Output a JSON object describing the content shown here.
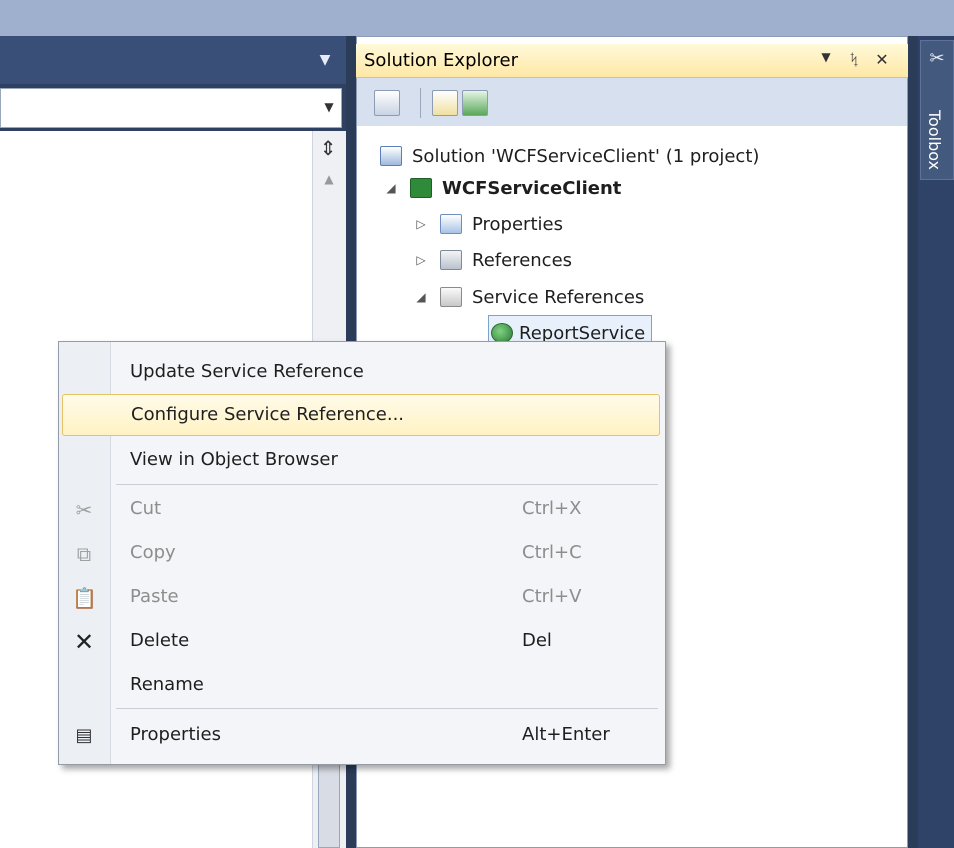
{
  "solution_explorer": {
    "title": "Solution Explorer",
    "tree": {
      "solution": "Solution 'WCFServiceClient' (1 project)",
      "project": "WCFServiceClient",
      "properties": "Properties",
      "references": "References",
      "service_references": "Service References",
      "report_service": "ReportService"
    }
  },
  "toolbox": {
    "label": "Toolbox"
  },
  "context_menu": {
    "items": [
      {
        "label": "Update Service Reference",
        "shortcut": "",
        "state": "normal"
      },
      {
        "label": "Configure Service Reference...",
        "shortcut": "",
        "state": "highlighted"
      },
      {
        "label": "View in Object Browser",
        "shortcut": "",
        "state": "normal"
      },
      {
        "label": "Cut",
        "shortcut": "Ctrl+X",
        "state": "disabled"
      },
      {
        "label": "Copy",
        "shortcut": "Ctrl+C",
        "state": "disabled"
      },
      {
        "label": "Paste",
        "shortcut": "Ctrl+V",
        "state": "disabled"
      },
      {
        "label": "Delete",
        "shortcut": "Del",
        "state": "normal"
      },
      {
        "label": "Rename",
        "shortcut": "",
        "state": "normal"
      },
      {
        "label": "Properties",
        "shortcut": "Alt+Enter",
        "state": "normal"
      }
    ]
  },
  "colors": {
    "highlight": "#fff2c4",
    "titlebar": "#ffe8a6",
    "ide_background": "#2b3c59"
  }
}
